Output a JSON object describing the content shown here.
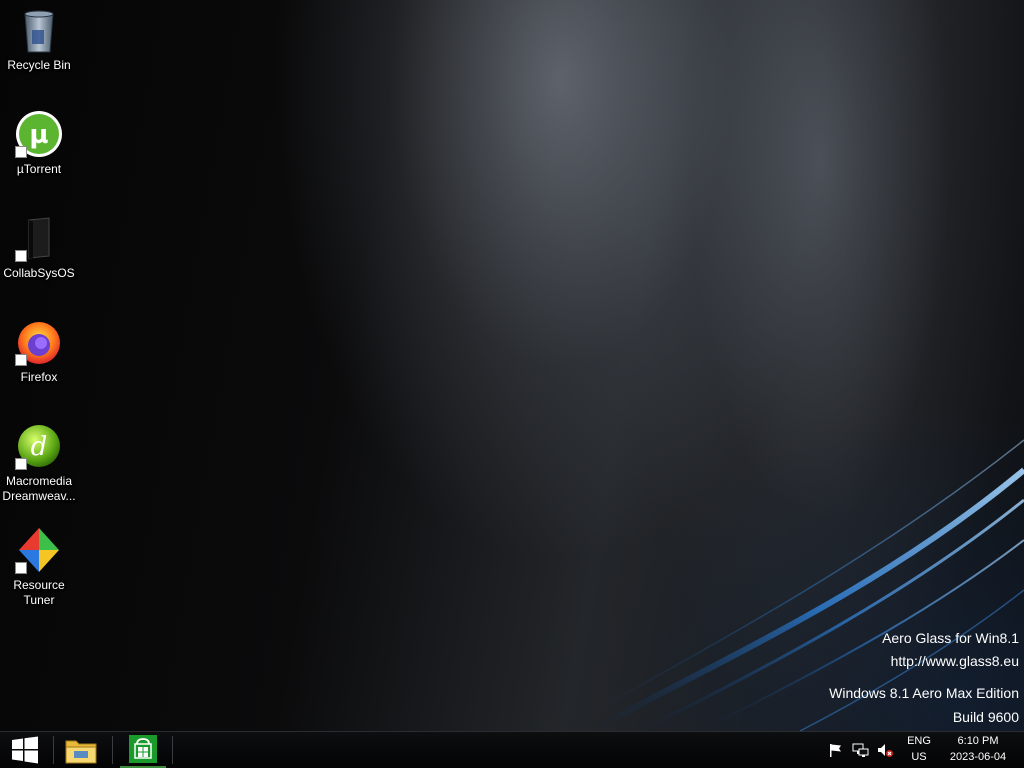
{
  "desktop": {
    "icons": [
      {
        "name": "recycle-bin-icon",
        "label": "Recycle Bin"
      },
      {
        "name": "utorrent-icon",
        "label": "µTorrent"
      },
      {
        "name": "collabsysos-icon",
        "label": "CollabSysOS"
      },
      {
        "name": "firefox-icon",
        "label": "Firefox"
      },
      {
        "name": "dreamweaver-icon",
        "label": "Macromedia Dreamweav..."
      },
      {
        "name": "resource-tuner-icon",
        "label": "Resource Tuner"
      }
    ],
    "watermark": {
      "line1": "Aero Glass for Win8.1",
      "line2": "http://www.glass8.eu",
      "line3": "Windows 8.1 Aero Max Edition",
      "line4": "Build 9600"
    }
  },
  "taskbar": {
    "pinned": [
      {
        "name": "start-button"
      },
      {
        "name": "file-explorer-button"
      },
      {
        "name": "store-button"
      }
    ],
    "tray": {
      "language_top": "ENG",
      "language_bottom": "US",
      "time": "6:10 PM",
      "date": "2023-06-04"
    }
  },
  "colors": {
    "utorrent": "#5cb531",
    "store": "#1a9a2a",
    "windows_logo": "#ffffff"
  }
}
